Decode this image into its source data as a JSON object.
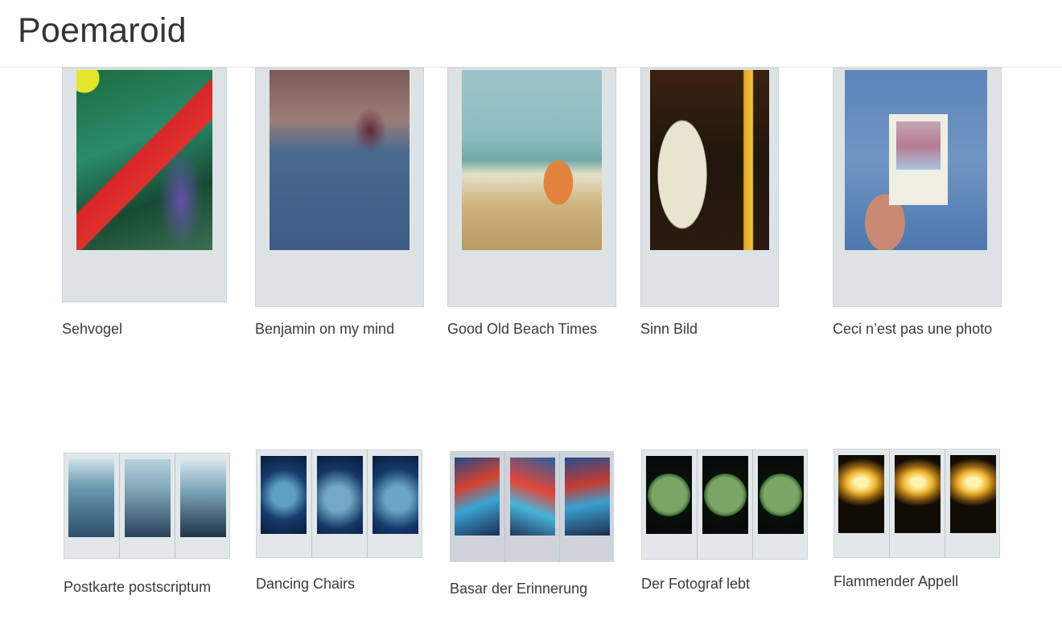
{
  "site": {
    "title": "Poemaroid"
  },
  "gallery": [
    {
      "title": "Sehvogel",
      "format": "single",
      "photo": "ph-sehvogel"
    },
    {
      "title": "Benjamin on my mind",
      "format": "single",
      "photo": "ph-benjamin"
    },
    {
      "title": "Good Old Beach Times",
      "format": "single",
      "photo": "ph-beach"
    },
    {
      "title": "Sinn Bild",
      "format": "single",
      "photo": "ph-sinn"
    },
    {
      "title": "Ceci n’est pas une photo",
      "format": "single",
      "photo": "ph-ceci"
    },
    {
      "title": "Postkarte postscriptum",
      "format": "triptych",
      "photos": [
        "p-venice1",
        "p-venice2",
        "p-venice3"
      ]
    },
    {
      "title": "Dancing Chairs",
      "format": "triptych",
      "photos": [
        "p-chair1",
        "p-chair2",
        "p-chair3"
      ]
    },
    {
      "title": "Basar der Erinnerung",
      "format": "triptych",
      "photos": [
        "p-basar1",
        "p-basar2",
        "p-basar3"
      ]
    },
    {
      "title": "Der Fotograf lebt",
      "format": "triptych",
      "photos": [
        "p-globe",
        "p-globe",
        "p-globe"
      ]
    },
    {
      "title": "Flammender Appell",
      "format": "triptych",
      "photos": [
        "p-fire",
        "p-fire",
        "p-fire"
      ]
    }
  ]
}
